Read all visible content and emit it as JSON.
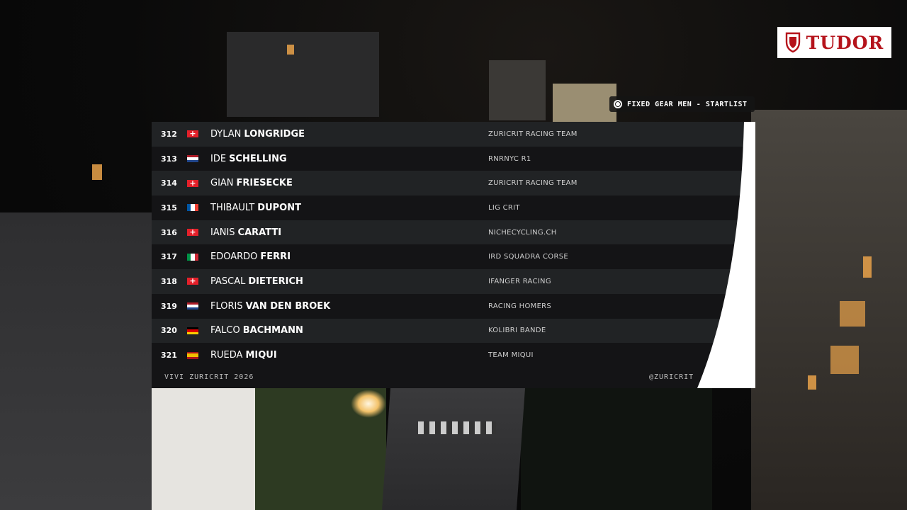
{
  "brand": {
    "logo_text": "TUDOR",
    "logo_color": "#b5131b"
  },
  "heading": {
    "label": "FIXED GEAR MEN - STARTLIST"
  },
  "startlist": {
    "riders": [
      {
        "number": "312",
        "flag": "switzerland-flag-icon",
        "first": "DYLAN",
        "last": "LONGRIDGE",
        "team": "ZURICRIT RACING TEAM"
      },
      {
        "number": "313",
        "flag": "netherlands-flag-icon",
        "first": "IDE",
        "last": "SCHELLING",
        "team": "RNRNYC R1"
      },
      {
        "number": "314",
        "flag": "switzerland-flag-icon",
        "first": "GIAN",
        "last": "FRIESECKE",
        "team": "ZURICRIT RACING TEAM"
      },
      {
        "number": "315",
        "flag": "france-flag-icon",
        "first": "THIBAULT",
        "last": "DUPONT",
        "team": "LIG CRIT"
      },
      {
        "number": "316",
        "flag": "switzerland-flag-icon",
        "first": "IANIS",
        "last": "CARATTI",
        "team": "NICHECYCLING.CH"
      },
      {
        "number": "317",
        "flag": "italy-flag-icon",
        "first": "EDOARDO",
        "last": "FERRI",
        "team": "IRD SQUADRA CORSE"
      },
      {
        "number": "318",
        "flag": "switzerland-flag-icon",
        "first": "PASCAL",
        "last": "DIETERICH",
        "team": "IFANGER RACING"
      },
      {
        "number": "319",
        "flag": "netherlands-flag-icon",
        "first": "FLORIS",
        "last": "VAN DEN BROEK",
        "team": "RACING HOMERS"
      },
      {
        "number": "320",
        "flag": "germany-flag-icon",
        "first": "FALCO",
        "last": "BACHMANN",
        "team": "KOLIBRI BANDE"
      },
      {
        "number": "321",
        "flag": "spain-flag-icon",
        "first": "RUEDA",
        "last": "MIQUI",
        "team": "TEAM MIQUI"
      }
    ]
  },
  "footer": {
    "left": "VIVI ZURICRIT 2026",
    "right": "@ZURICRIT"
  }
}
